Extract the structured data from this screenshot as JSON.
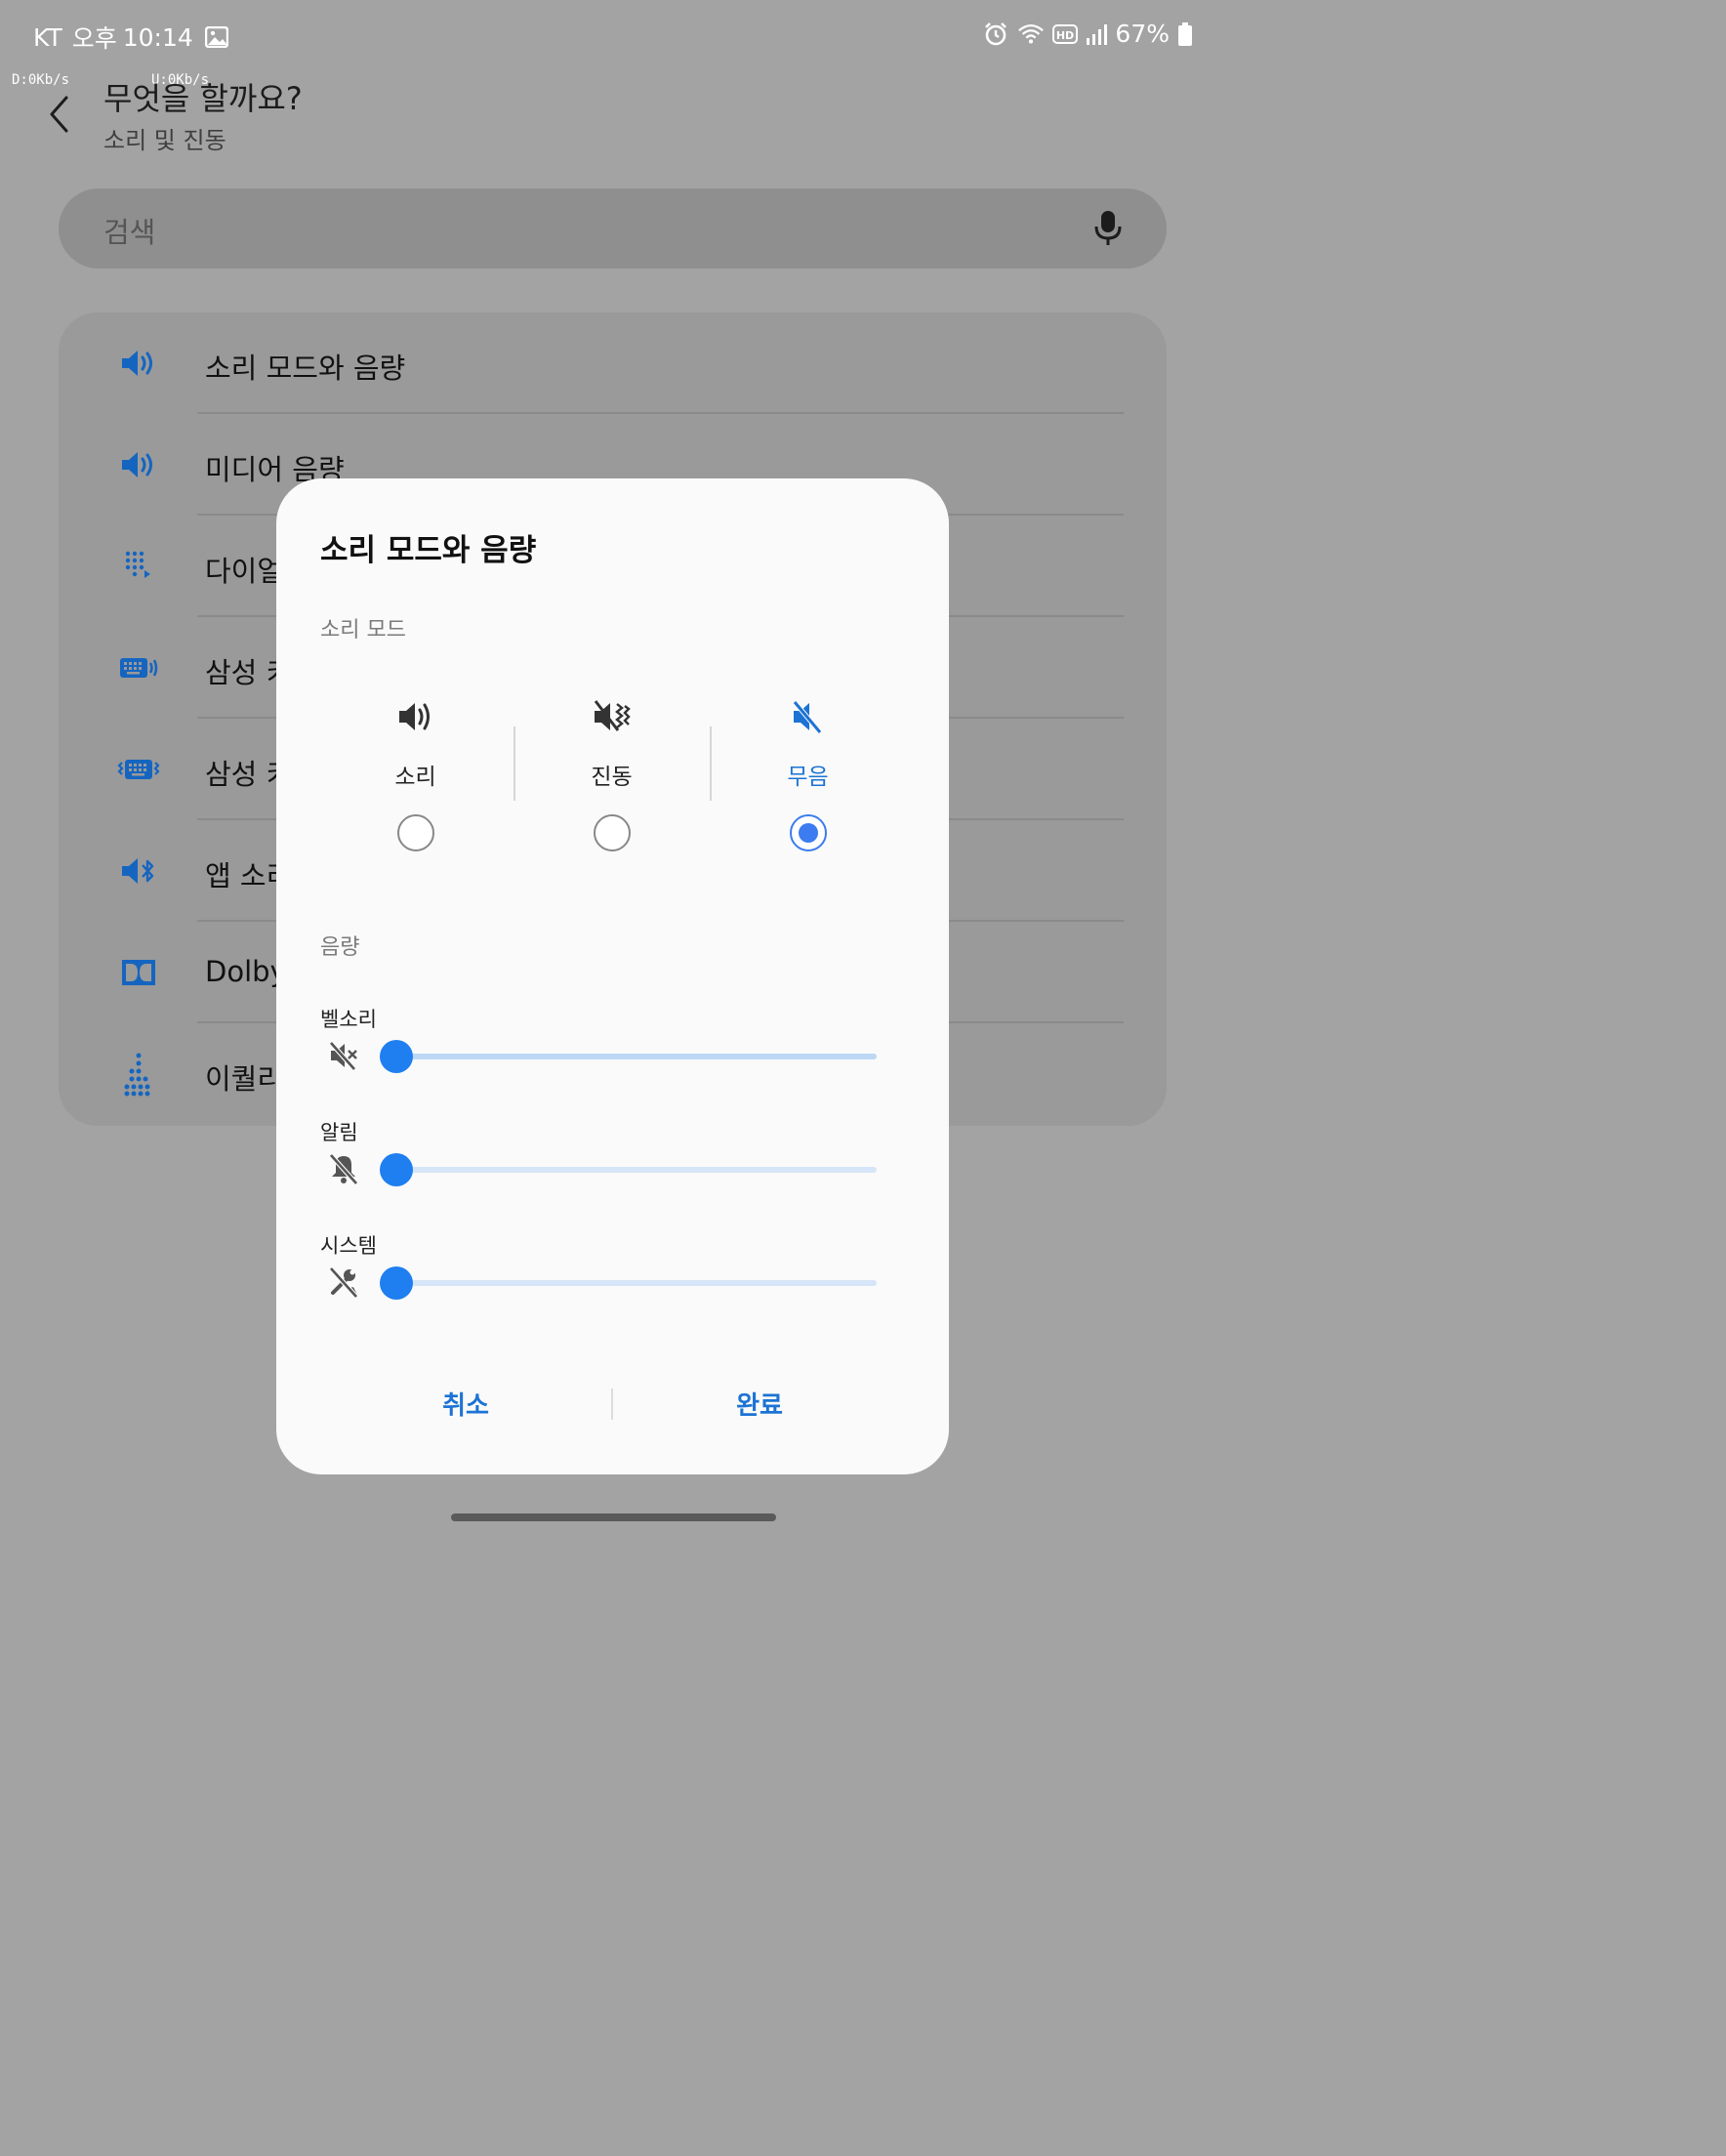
{
  "status_bar": {
    "carrier": "KT",
    "ampm": "오후",
    "time": "10:14",
    "battery": "67%",
    "download_speed": "D:0Kb/s",
    "upload_speed": "U:0Kb/s",
    "icons": [
      "gallery-icon",
      "alarm-icon",
      "wifi-icon",
      "hd-icon",
      "signal-icon",
      "battery-icon"
    ]
  },
  "header": {
    "title": "무엇을 할까요?",
    "subtitle": "소리 및 진동"
  },
  "search": {
    "placeholder": "검색"
  },
  "settings_list": [
    {
      "label": "소리 모드와 음량",
      "icon": "volume-icon"
    },
    {
      "label": "미디어 음량",
      "icon": "volume-icon"
    },
    {
      "label": "다이얼",
      "icon": "dialpad-icon"
    },
    {
      "label": "삼성 키",
      "icon": "keyboard-sound-icon"
    },
    {
      "label": "삼성 키",
      "icon": "keyboard-vibrate-icon"
    },
    {
      "label": "앱 소리",
      "icon": "bluetooth-audio-icon"
    },
    {
      "label": "Dolby",
      "icon": "dolby-icon"
    },
    {
      "label": "이퀄리",
      "icon": "equalizer-icon"
    }
  ],
  "dialog": {
    "title": "소리 모드와 음량",
    "mode_section": "소리 모드",
    "modes": [
      {
        "label": "소리",
        "icon": "sound-icon",
        "selected": false
      },
      {
        "label": "진동",
        "icon": "vibrate-icon",
        "selected": false
      },
      {
        "label": "무음",
        "icon": "mute-icon",
        "selected": true
      }
    ],
    "volume_section": "음량",
    "volumes": [
      {
        "label": "벨소리",
        "icon": "ringtone-muted-icon",
        "level": 0
      },
      {
        "label": "알림",
        "icon": "notification-muted-icon",
        "level": 0
      },
      {
        "label": "시스템",
        "icon": "system-muted-icon",
        "level": 0
      }
    ],
    "cancel": "취소",
    "done": "완료"
  },
  "colors": {
    "accent": "#1f7ef0",
    "accent_text": "#1c73d4",
    "icon_blue": "#1565c0",
    "scrim_bg": "#a3a3a3"
  }
}
